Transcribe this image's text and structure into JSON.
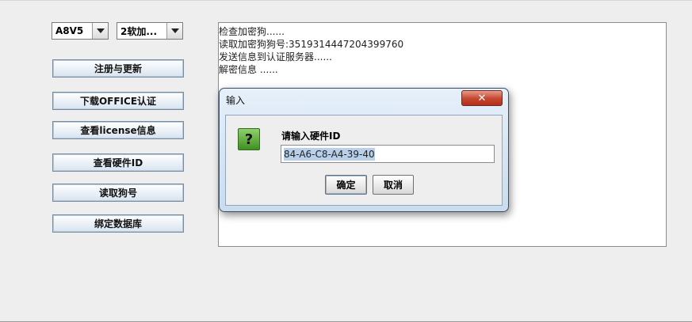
{
  "combos": {
    "model_value": "A8V5",
    "software_value": "2软加..."
  },
  "buttons": {
    "register": "注册与更新",
    "download_office": "下载OFFICE认证",
    "view_license": "查看license信息",
    "view_hardware": "查看硬件ID",
    "read_dongle": "读取狗号",
    "bind_db": "绑定数据库"
  },
  "log": {
    "lines": [
      "检查加密狗......",
      "读取加密狗狗号:3519314447204399760",
      "发送信息到认证服务器......",
      "解密信息 ......"
    ]
  },
  "dialog": {
    "title": "输入",
    "close_glyph": "✕",
    "icon_glyph": "?",
    "prompt": "请输入硬件ID",
    "input_value": "84-A6-C8-A4-39-40",
    "ok_label": "确定",
    "cancel_label": "取消"
  }
}
